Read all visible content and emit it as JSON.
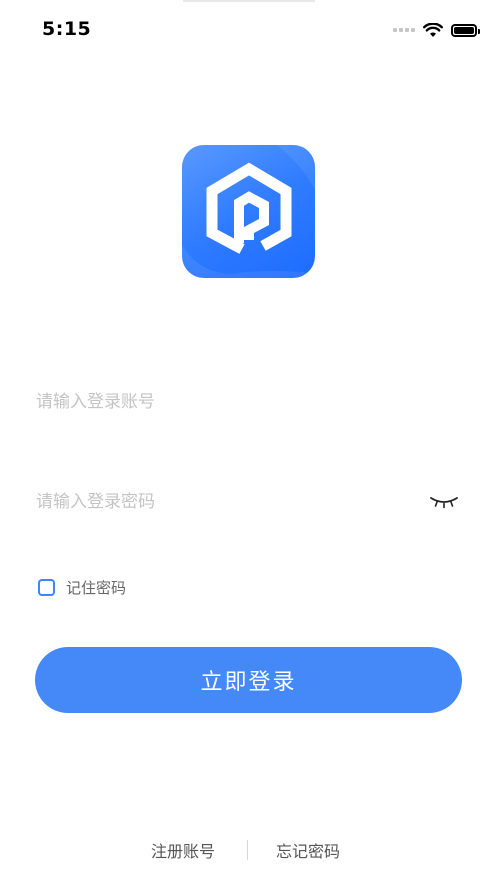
{
  "status_bar": {
    "time": "5:15",
    "icons": [
      "signal-dots-icon",
      "wifi-icon",
      "battery-icon"
    ]
  },
  "logo": {
    "icon": "app-logo-icon",
    "brand_color": "#2f7cff"
  },
  "form": {
    "account_placeholder": "请输入登录账号",
    "account_value": "",
    "password_placeholder": "请输入登录密码",
    "password_value": "",
    "password_toggle_icon": "eye-closed-icon",
    "remember_label": "记住密码",
    "remember_checked": false,
    "login_label": "立即登录"
  },
  "bottom_links": {
    "register": "注册账号",
    "forgot": "忘记密码"
  },
  "colors": {
    "accent": "#4589f8",
    "placeholder": "#c4c4c4"
  }
}
